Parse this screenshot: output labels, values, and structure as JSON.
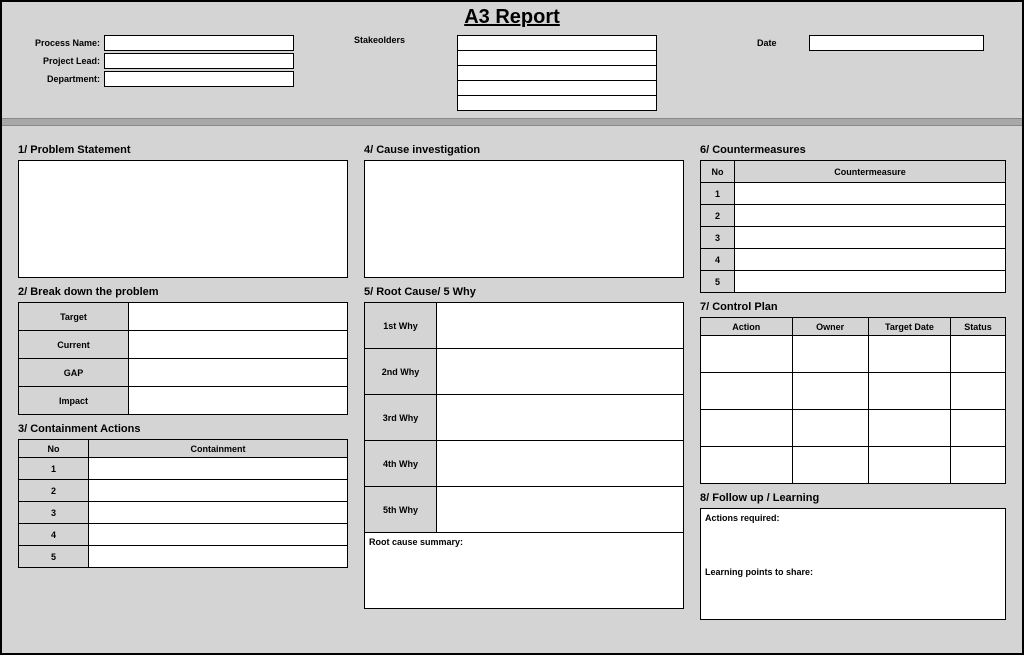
{
  "title": "A3 Report",
  "header": {
    "processName": "Process Name:",
    "projectLead": "Project Lead:",
    "department": "Department:",
    "stakeholders": "Stakeolders",
    "date": "Date"
  },
  "sections": {
    "s1": "1/ Problem Statement",
    "s2": "2/ Break down the problem",
    "s3": "3/ Containment Actions",
    "s4": "4/ Cause investigation",
    "s5": "5/ Root Cause/ 5 Why",
    "s6": "6/ Countermeasures",
    "s7": "7/ Control Plan",
    "s8": "8/ Follow up / Learning"
  },
  "breakdown": {
    "target": "Target",
    "current": "Current",
    "gap": "GAP",
    "impact": "Impact"
  },
  "containment": {
    "noHeader": "No",
    "containmentHeader": "Containment",
    "rows": [
      "1",
      "2",
      "3",
      "4",
      "5"
    ]
  },
  "why": {
    "w1": "1st Why",
    "w2": "2nd Why",
    "w3": "3rd Why",
    "w4": "4th Why",
    "w5": "5th Why",
    "summary": "Root cause summary:"
  },
  "counter": {
    "noHeader": "No",
    "cmHeader": "Countermeasure",
    "rows": [
      "1",
      "2",
      "3",
      "4",
      "5"
    ]
  },
  "control": {
    "action": "Action",
    "owner": "Owner",
    "targetDate": "Target Date",
    "status": "Status"
  },
  "follow": {
    "actions": "Actions required:",
    "learning": "Learning points to share:"
  }
}
